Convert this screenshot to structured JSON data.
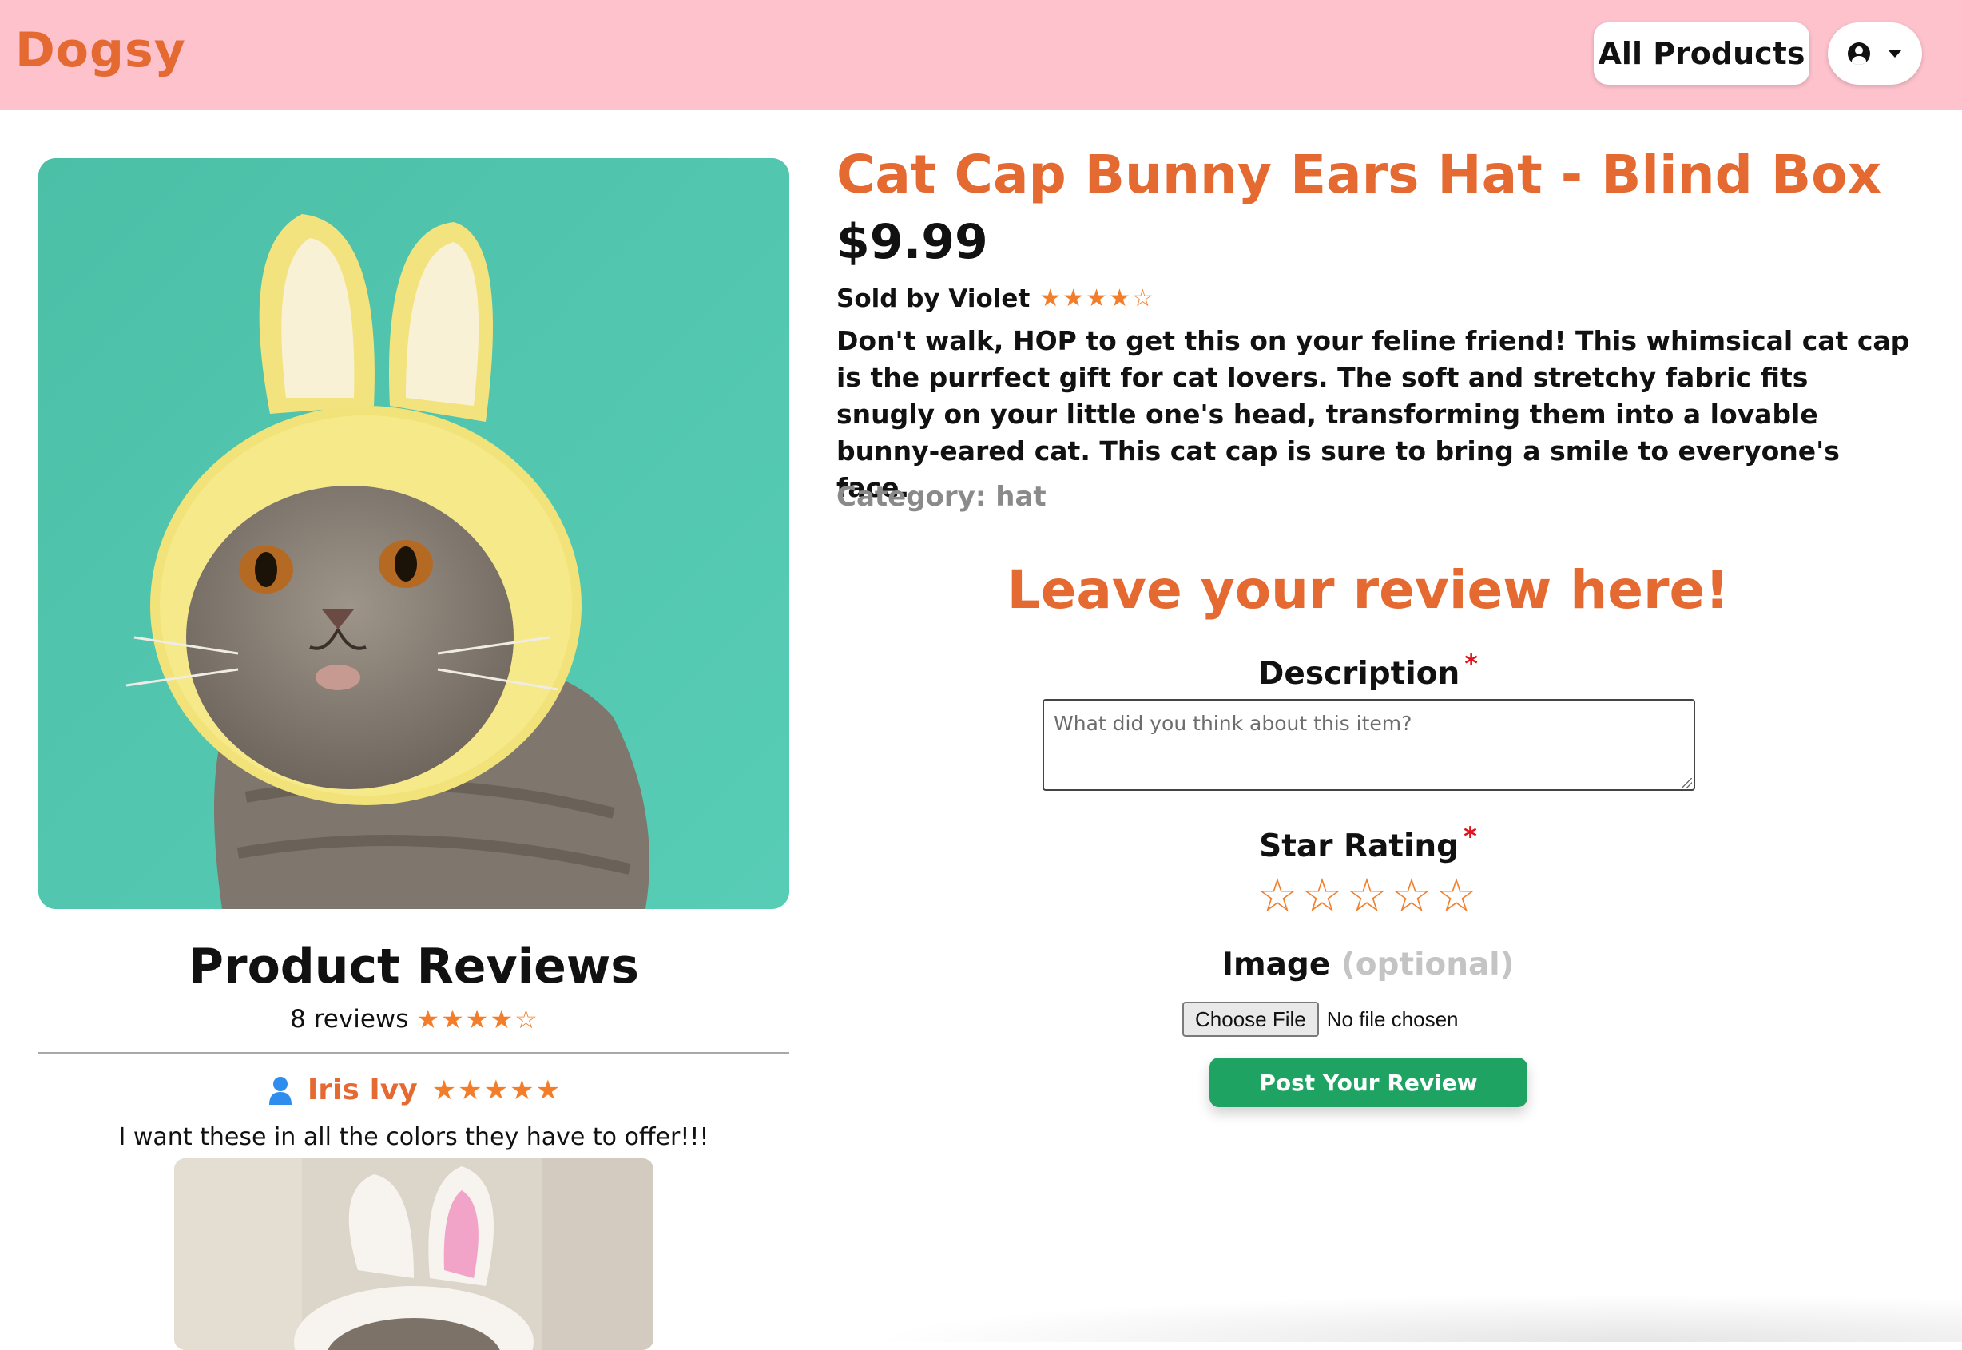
{
  "header": {
    "brand": "Dogsy",
    "all_products_label": "All Products",
    "user_icon": "user-circle-icon",
    "dropdown_icon": "caret-down-icon",
    "background_color": "#fec2cd",
    "brand_color": "#e46a32"
  },
  "product": {
    "title": "Cat Cap Bunny Ears Hat - Blind Box",
    "price": "$9.99",
    "sold_by": "Sold by Violet",
    "rating": 4,
    "description": "Don't walk, HOP to get this on your feline friend! This whimsical cat cap is the purrfect gift for cat lovers. The soft and stretchy fabric fits snugly on your little one's head, transforming them into a lovable bunny-eared cat. This cat cap is sure to bring a smile to everyone's face.",
    "category": "Category: hat",
    "image_background_color": "#52c7b0"
  },
  "reviews": {
    "title": "Product Reviews",
    "count_text": "8 reviews",
    "average_rating": 4,
    "items": [
      {
        "author": "Iris Ivy",
        "rating": 5,
        "text": "I want these in all the colors they have to offer!!!",
        "avatar_icon": "user-icon"
      }
    ]
  },
  "review_form": {
    "heading": "Leave your review here!",
    "description_label": "Description",
    "required_marker": "*",
    "description_placeholder": "What did you think about this item?",
    "description_value": "",
    "star_rating_label": "Star Rating",
    "star_rating_value": 0,
    "image_label": "Image",
    "image_optional": "(optional)",
    "choose_file_label": "Choose File",
    "file_status": "No file chosen",
    "submit_label": "Post Your Review",
    "submit_color": "#1ea362"
  },
  "colors": {
    "accent": "#e46a32",
    "star": "#f27e2b",
    "required": "#e1121d"
  }
}
